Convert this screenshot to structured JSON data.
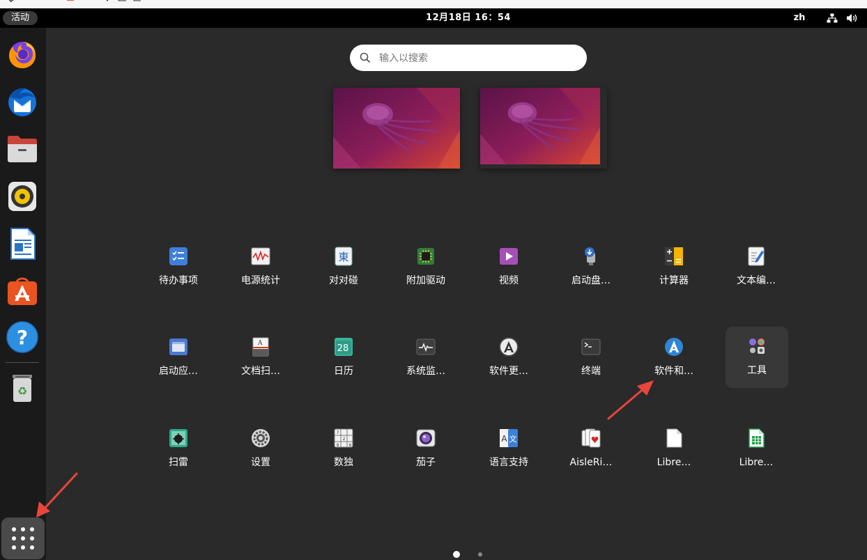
{
  "topbar": {
    "activities_label": "活动",
    "clock": "12月18日  16：54",
    "input_method": "zh"
  },
  "dock": {
    "items": [
      {
        "name": "firefox",
        "icon": "firefox-icon"
      },
      {
        "name": "thunderbird",
        "icon": "thunderbird-icon"
      },
      {
        "name": "files",
        "icon": "files-icon"
      },
      {
        "name": "rhythmbox",
        "icon": "rhythmbox-icon"
      },
      {
        "name": "libreoffice-writer",
        "icon": "writer-icon"
      },
      {
        "name": "ubuntu-software",
        "icon": "software-icon"
      },
      {
        "name": "help",
        "icon": "help-icon"
      },
      {
        "name": "trash",
        "icon": "trash-icon"
      }
    ],
    "show_apps_icon": "grid-icon"
  },
  "search": {
    "placeholder": "输入以搜索",
    "value": ""
  },
  "apps": [
    {
      "label": "待办事项",
      "icon": "todo-icon"
    },
    {
      "label": "电源统计",
      "icon": "power-statistics-icon"
    },
    {
      "label": "对对碰",
      "icon": "mahjongg-icon"
    },
    {
      "label": "附加驱动",
      "icon": "chip-icon"
    },
    {
      "label": "视频",
      "icon": "video-play-icon"
    },
    {
      "label": "启动盘…",
      "icon": "usb-creator-icon"
    },
    {
      "label": "计算器",
      "icon": "calculator-icon"
    },
    {
      "label": "文本编…",
      "icon": "text-editor-icon"
    },
    {
      "label": "启动应…",
      "icon": "startup-apps-icon"
    },
    {
      "label": "文档扫…",
      "icon": "document-scanner-icon"
    },
    {
      "label": "日历",
      "icon": "calendar-icon"
    },
    {
      "label": "系统监…",
      "icon": "system-monitor-icon"
    },
    {
      "label": "软件更…",
      "icon": "software-updater-icon"
    },
    {
      "label": "终端",
      "icon": "terminal-icon"
    },
    {
      "label": "软件和…",
      "icon": "software-sources-icon"
    },
    {
      "label": "工具",
      "icon": "folder-tools-icon"
    },
    {
      "label": "扫雷",
      "icon": "mines-icon"
    },
    {
      "label": "设置",
      "icon": "settings-gear-icon"
    },
    {
      "label": "数独",
      "icon": "sudoku-icon"
    },
    {
      "label": "茄子",
      "icon": "cheese-icon"
    },
    {
      "label": "语言支持",
      "icon": "language-icon"
    },
    {
      "label": "AisleRi…",
      "icon": "aisleriot-icon"
    },
    {
      "label": "Libre…",
      "icon": "libreoffice-icon"
    },
    {
      "label": "Libre…",
      "icon": "libreoffice-calc-icon"
    }
  ],
  "calendar_icon_day": "28",
  "pagination": {
    "pages": 2,
    "current": 1
  },
  "colors": {
    "topbar": "#000000",
    "dock": "#1a1a1a",
    "overview_bg": "#2a2a2a",
    "annotation_arrow": "#e8463c",
    "ubuntu_orange": "#e95420"
  }
}
